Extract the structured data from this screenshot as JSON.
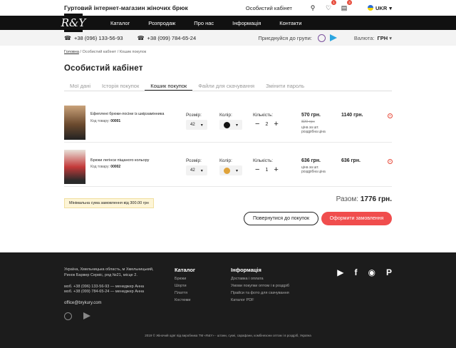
{
  "header": {
    "tagline": "Гуртовий інтернет-магазин жіночих брюк",
    "account_link": "Особистий кабінет",
    "wishlist_count": "1",
    "cart_count": "3",
    "lang": "UKR"
  },
  "logo": "R&Y",
  "nav": [
    "Каталог",
    "Розпродаж",
    "Про нас",
    "Інформація",
    "Контакти"
  ],
  "contacts": {
    "phone1": "+38 (096) 133-56-93",
    "phone2": "+38 (099) 784-65-24",
    "join": "Приєднуйся до групи:",
    "currency_label": "Валюта:",
    "currency": "ГРН"
  },
  "breadcrumb": {
    "home": "Головна",
    "account": "Особистий кабінет",
    "current": "Кошик покупок"
  },
  "page_title": "Особистий кабінет",
  "tabs": [
    "Мої дані",
    "Історія покупок",
    "Кошик покупок",
    "Файли для скачування",
    "Змінити пароль"
  ],
  "labels": {
    "size": "Розмір:",
    "color": "Колір:",
    "qty": "Кількість:",
    "code": "Код товару:",
    "per": "ціна за шт. роздрібна ціна",
    "per2": "ціна за шт. роздрібна ціна"
  },
  "items": [
    {
      "name": "Ефеплені брюки-лосіни із шкірзамінника",
      "code": "00001",
      "size": "42",
      "qty": "2",
      "price": "570 грн.",
      "old": "820 грн",
      "total": "1140 грн."
    },
    {
      "name": "Брюки легінси піщаного кольору",
      "code": "00002",
      "size": "42",
      "qty": "1",
      "price": "636 грн.",
      "old": "",
      "total": "636 грн."
    }
  ],
  "min_order": "Мінімальна сума замовлення від 300.00 грн",
  "sum_label": "Разом:",
  "sum_value": "1776 грн.",
  "buttons": {
    "back": "Повернутися до покупок",
    "checkout": "Оформити замовлення"
  },
  "footer": {
    "address": "Україна, Хмельницька область, м Хмельницький, Ринок Барвер Сервіс, ряд №21, місце 2.",
    "phone1": "моб. +38 (096) 133-56-93 — менеджер Анна",
    "phone2": "моб. +38 (099) 784-65-24 — менеджер Анна",
    "email": "office@brykury.com",
    "catalog_title": "Каталог",
    "catalog": [
      "Брюки",
      "Шорти",
      "Плаття",
      "Костюми"
    ],
    "info_title": "Інформація",
    "info": [
      "Доставка і оплата",
      "Умови покупки оптом і в роздріб",
      "Прайси та фото для скачування",
      "Каталог PDF"
    ],
    "copyright": "2019 © Жіночий одяг від виробника ТМ «R&Y» - штани, сукні, сарафани, комбінезони оптом і в роздріб, Україна"
  },
  "colors": {
    "accent": "#f04d4d",
    "nav_bg": "#111111",
    "footer_bg": "#1c1c1c",
    "item1_color": "#111111",
    "item2_color": "#e0a33a"
  }
}
